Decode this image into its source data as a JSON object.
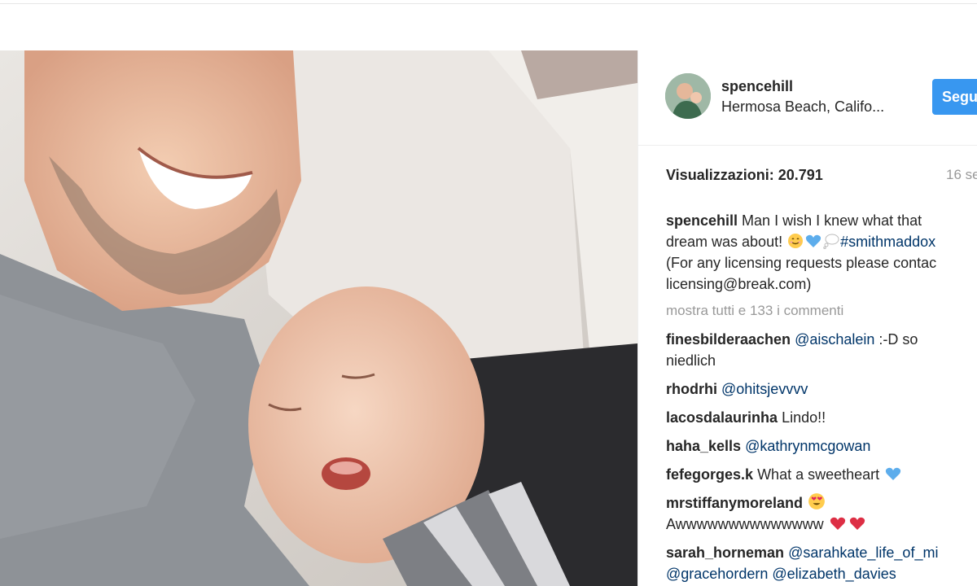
{
  "post": {
    "username": "spencehill",
    "location": "Hermosa Beach, Califo...",
    "follow_label": "Segui",
    "views": "Visualizzazioni: 20.791",
    "date": "16 se",
    "caption": {
      "username": "spencehill",
      "line1_text": "Man I wish I knew what that",
      "line2_text": "dream was about!",
      "line2_hashtag": "#smithmaddox",
      "line3_text": "(For any licensing requests please contac",
      "line4_text": "licensing@break.com)"
    },
    "show_all_comments": "mostra tutti e 133 i commenti"
  },
  "comments": [
    {
      "user": "finesbilderaachen",
      "mention": "@aischalein",
      "text": ":-D so",
      "text2": "niedlich"
    },
    {
      "user": "rhodrhi",
      "mention": "@ohitsjevvvv",
      "text": ""
    },
    {
      "user": "lacosdalaurinha",
      "mention": "",
      "text": "Lindo!!"
    },
    {
      "user": "haha_kells",
      "mention": "@kathrynmcgowan",
      "text": ""
    },
    {
      "user": "fefegorges.k",
      "mention": "",
      "text": "What a sweetheart"
    },
    {
      "user": "mrstiffanymoreland",
      "mention": "",
      "text": "",
      "text2": "Awwwwwwwwwwwwww"
    },
    {
      "user": "sarah_horneman",
      "mention": "@sarahkate_life_of_mi",
      "text": "",
      "mention2": "@gracehordern",
      "mention3": "@elizabeth_davies"
    }
  ],
  "icons": {
    "caption_emojis": [
      "smiling-face-icon",
      "blue-heart-icon",
      "thought-balloon-icon"
    ],
    "sweetheart_emoji": "blue-heart-icon",
    "tiffany_emojis": [
      "heart-eyes-icon",
      "red-heart-icon",
      "red-heart-icon"
    ]
  },
  "colors": {
    "accent_blue": "#3897f0",
    "link": "#003569",
    "muted": "#999999"
  }
}
